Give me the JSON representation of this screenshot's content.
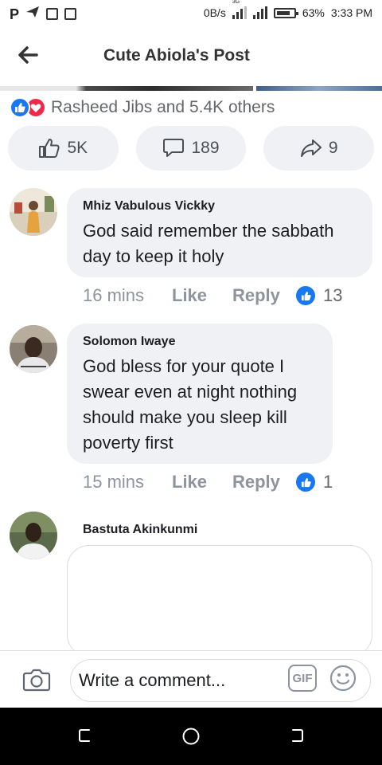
{
  "status_bar": {
    "left_icons": [
      "p-icon",
      "send-icon",
      "image-icon",
      "storage-icon"
    ],
    "left_glyph": "P",
    "network_speed": "0B/s",
    "network_type": "3G",
    "battery": "63%",
    "time": "3:33 PM"
  },
  "header": {
    "title": "Cute Abiola's Post"
  },
  "reactions": {
    "summary": "Rasheed Jibs and 5.4K others"
  },
  "actions": {
    "likes": "5K",
    "comments": "189",
    "shares": "9"
  },
  "comments": [
    {
      "author": "Mhiz Vabulous Vickky",
      "text": "God said remember the sabbath day to keep it holy",
      "time": "16 mins",
      "like_label": "Like",
      "reply_label": "Reply",
      "reaction_count": "13"
    },
    {
      "author": "Solomon  Iwaye",
      "text": "God bless for your quote I swear even at night nothing should make you sleep kill poverty first",
      "time": "15 mins",
      "like_label": "Like",
      "reply_label": "Reply",
      "reaction_count": "1"
    },
    {
      "author": "Bastuta Akinkunmi",
      "text": ""
    }
  ],
  "composer": {
    "value": "Write a comment...",
    "gif_label": "GIF"
  },
  "colors": {
    "accent": "#1877f2",
    "love": "#f02849",
    "bubble": "#eff1f4",
    "muted": "#8d949e"
  }
}
